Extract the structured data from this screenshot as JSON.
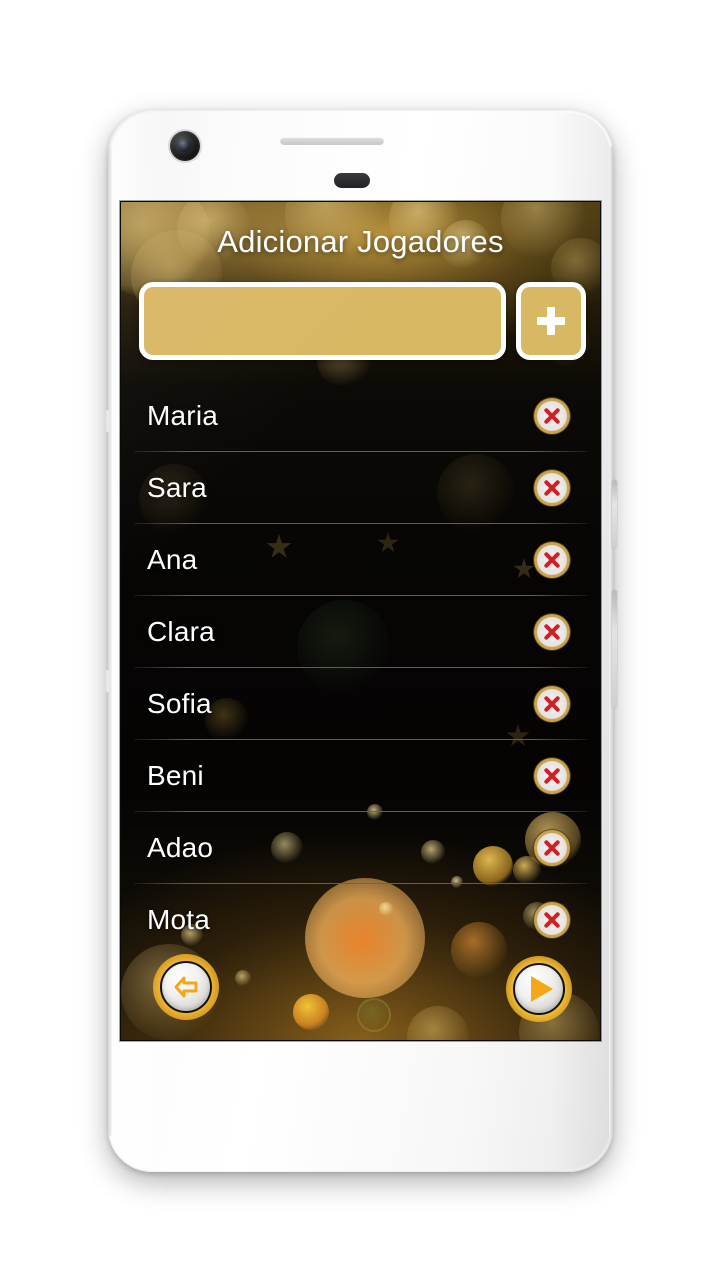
{
  "app": {
    "title": "Adicionar Jogadores",
    "accent_gold": "#d9b864",
    "accent_orange": "#f5a718",
    "delete_red": "#cf2026",
    "text_color": "#ffffff",
    "screen_background": "#050403"
  },
  "input": {
    "value": "",
    "placeholder": "",
    "add_label": "+"
  },
  "players": [
    {
      "name": "Maria",
      "delete_label": "x"
    },
    {
      "name": "Sara",
      "delete_label": "x"
    },
    {
      "name": "Ana",
      "delete_label": "x"
    },
    {
      "name": "Clara",
      "delete_label": "x"
    },
    {
      "name": "Sofia",
      "delete_label": "x"
    },
    {
      "name": "Beni",
      "delete_label": "x"
    },
    {
      "name": "Adao",
      "delete_label": "x"
    },
    {
      "name": "Mota",
      "delete_label": "x"
    }
  ],
  "nav": {
    "back_label": "Voltar",
    "play_label": "Jogar"
  },
  "device": {
    "frame_color": "#ffffff",
    "kind": "smartphone"
  }
}
